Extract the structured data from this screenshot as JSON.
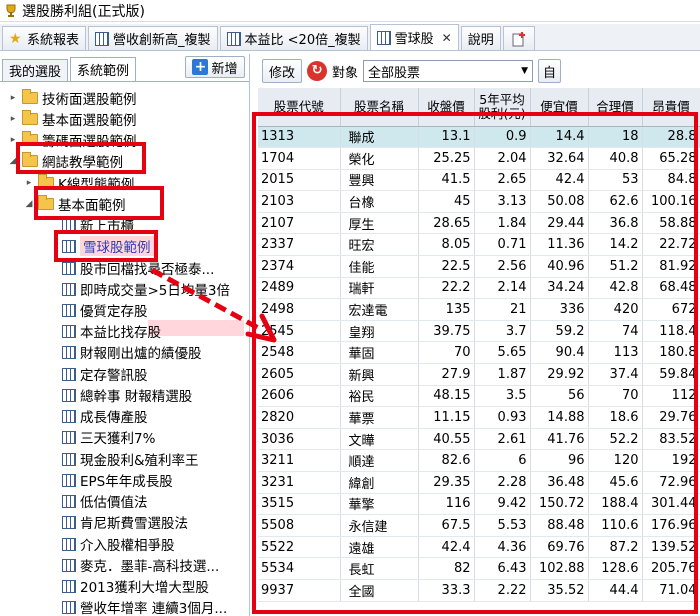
{
  "window": {
    "title": "選股勝利組(正式版)"
  },
  "tabs": [
    {
      "label": "系統報表",
      "icon": "star-icon"
    },
    {
      "label": "營收創新高_複製",
      "icon": "grid-icon"
    },
    {
      "label": "本益比 <20倍_複製",
      "icon": "grid-icon"
    },
    {
      "label": "雪球股",
      "icon": "grid-icon",
      "active": true,
      "close": "✕"
    },
    {
      "label": "說明",
      "icon": ""
    },
    {
      "label": "",
      "icon": "add-tab-icon"
    }
  ],
  "left_panel": {
    "tabs": [
      "我的選股",
      "系統範例"
    ],
    "new_button": "新增",
    "tree": [
      {
        "label": "技術面選股範例",
        "type": "folder",
        "level": 0,
        "arrow": "▸"
      },
      {
        "label": "基本面選股範例",
        "type": "folder",
        "level": 0,
        "arrow": "▸"
      },
      {
        "label": "籌碼面選股範例",
        "type": "folder",
        "level": 0,
        "arrow": "▸"
      },
      {
        "label": "網誌教學範例",
        "type": "folder",
        "level": 0,
        "arrow": "◢"
      },
      {
        "label": "K線型態範例",
        "type": "folder",
        "level": 1,
        "arrow": "▸"
      },
      {
        "label": "基本面範例",
        "type": "folder",
        "level": 1,
        "arrow": "◢"
      },
      {
        "label": "新上市櫃",
        "type": "item",
        "level": 2
      },
      {
        "label": "雪球股範例",
        "type": "item",
        "level": 2,
        "selected": true
      },
      {
        "label": "股市回檔找尋否極泰...",
        "type": "item",
        "level": 2
      },
      {
        "label": "即時成交量>5日均量3倍",
        "type": "item",
        "level": 2
      },
      {
        "label": "優質定存股",
        "type": "item",
        "level": 2
      },
      {
        "label": "本益比找存股",
        "type": "item",
        "level": 2
      },
      {
        "label": "財報剛出爐的績優股",
        "type": "item",
        "level": 2
      },
      {
        "label": "定存警訊股",
        "type": "item",
        "level": 2
      },
      {
        "label": "總幹事 財報精選股",
        "type": "item",
        "level": 2
      },
      {
        "label": "成長傳產股",
        "type": "item",
        "level": 2
      },
      {
        "label": "三天獲利7%",
        "type": "item",
        "level": 2
      },
      {
        "label": "現金股利&殖利率王",
        "type": "item",
        "level": 2
      },
      {
        "label": "EPS年年成長股",
        "type": "item",
        "level": 2
      },
      {
        "label": "低估價值法",
        "type": "item",
        "level": 2
      },
      {
        "label": "肯尼斯費雪選股法",
        "type": "item",
        "level": 2
      },
      {
        "label": "介入股權相爭股",
        "type": "item",
        "level": 2
      },
      {
        "label": "麥克．墨菲-高科技選...",
        "type": "item",
        "level": 2
      },
      {
        "label": "2013獲利大增大型股",
        "type": "item",
        "level": 2
      },
      {
        "label": "營收年增率 連續3個月...",
        "type": "item",
        "level": 2
      }
    ]
  },
  "toolbar": {
    "edit_button": "修改",
    "target_label": "對象",
    "target_value": "全部股票",
    "self_button": "自"
  },
  "table": {
    "headers": [
      "股票代號",
      "股票名稱",
      "收盤價",
      "5年平均股利(元)",
      "便宜價",
      "合理價",
      "昂貴價"
    ],
    "rows": [
      [
        "1313",
        "聯成",
        "13.1",
        "0.9",
        "14.4",
        "18",
        "28.8"
      ],
      [
        "1704",
        "榮化",
        "25.25",
        "2.04",
        "32.64",
        "40.8",
        "65.28"
      ],
      [
        "2015",
        "豐興",
        "41.5",
        "2.65",
        "42.4",
        "53",
        "84.8"
      ],
      [
        "2103",
        "台橡",
        "45",
        "3.13",
        "50.08",
        "62.6",
        "100.16"
      ],
      [
        "2107",
        "厚生",
        "28.65",
        "1.84",
        "29.44",
        "36.8",
        "58.88"
      ],
      [
        "2337",
        "旺宏",
        "8.05",
        "0.71",
        "11.36",
        "14.2",
        "22.72"
      ],
      [
        "2374",
        "佳能",
        "22.5",
        "2.56",
        "40.96",
        "51.2",
        "81.92"
      ],
      [
        "2489",
        "瑞軒",
        "22.2",
        "2.14",
        "34.24",
        "42.8",
        "68.48"
      ],
      [
        "2498",
        "宏達電",
        "135",
        "21",
        "336",
        "420",
        "672"
      ],
      [
        "2545",
        "皇翔",
        "39.75",
        "3.7",
        "59.2",
        "74",
        "118.4"
      ],
      [
        "2548",
        "華固",
        "70",
        "5.65",
        "90.4",
        "113",
        "180.8"
      ],
      [
        "2605",
        "新興",
        "27.9",
        "1.87",
        "29.92",
        "37.4",
        "59.84"
      ],
      [
        "2606",
        "裕民",
        "48.15",
        "3.5",
        "56",
        "70",
        "112"
      ],
      [
        "2820",
        "華票",
        "11.15",
        "0.93",
        "14.88",
        "18.6",
        "29.76"
      ],
      [
        "3036",
        "文曄",
        "40.55",
        "2.61",
        "41.76",
        "52.2",
        "83.52"
      ],
      [
        "3211",
        "順達",
        "82.6",
        "6",
        "96",
        "120",
        "192"
      ],
      [
        "3231",
        "緯創",
        "29.35",
        "2.28",
        "36.48",
        "45.6",
        "72.96"
      ],
      [
        "3515",
        "華擎",
        "116",
        "9.42",
        "150.72",
        "188.4",
        "301.44"
      ],
      [
        "5508",
        "永信建",
        "67.5",
        "5.53",
        "88.48",
        "110.6",
        "176.96"
      ],
      [
        "5522",
        "遠雄",
        "42.4",
        "4.36",
        "69.76",
        "87.2",
        "139.52"
      ],
      [
        "5534",
        "長虹",
        "82",
        "6.43",
        "102.88",
        "128.6",
        "205.76"
      ],
      [
        "9937",
        "全國",
        "33.3",
        "2.22",
        "35.52",
        "44.4",
        "71.04"
      ]
    ]
  },
  "colors": {
    "annotation_red": "#e50012",
    "selected_row": "#cfe8ee",
    "accent_blue": "#2b79d6"
  }
}
